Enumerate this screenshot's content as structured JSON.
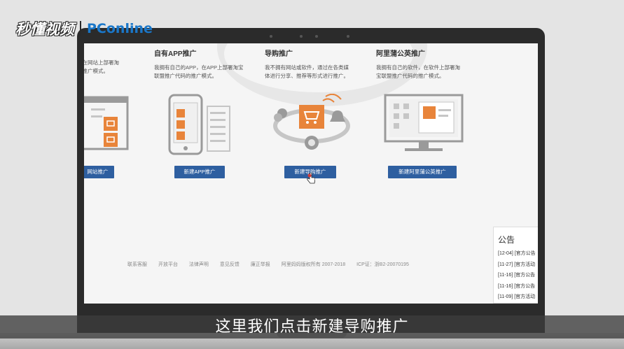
{
  "watermark": {
    "brand_cn": "秒懂视频",
    "brand_pc": "PConline"
  },
  "cards": [
    {
      "title": "",
      "desc": "，在网站上部署淘\n的推广模式。",
      "button": "网站推广"
    },
    {
      "title": "自有APP推广",
      "desc": "我拥有自己的APP，在APP上部署淘宝\n联盟推广代码的推广模式。",
      "button": "新建APP推广"
    },
    {
      "title": "导购推广",
      "desc": "我不拥有网站或软件，通过在各类媒\n体进行分享、推荐等形式进行推广。",
      "button": "新建导购推广"
    },
    {
      "title": "阿里蒲公英推广",
      "desc": "我拥有自己的软件，在软件上部署淘\n宝联盟推广代码的推广模式。",
      "button": "新建阿里蒲公英推广"
    }
  ],
  "footer": {
    "links": [
      "联系客服",
      "开放平台",
      "法律声明",
      "意见反馈",
      "廉正举报"
    ],
    "copyright": "阿里妈妈版权所有 2007-2018",
    "icp": "ICP证：浙B2-20070195"
  },
  "notice": {
    "title": "公告",
    "items": [
      "[12-04]   [官方公告",
      "[11-27]   [官方活动",
      "[11-16]   [官方公告",
      "[11-16]   [官方公告",
      "[11-09]   [官方活动"
    ]
  },
  "subtitle": "这里我们点击新建导购推广",
  "colors": {
    "button_blue": "#2e5fa0",
    "accent_orange": "#e8843a"
  }
}
